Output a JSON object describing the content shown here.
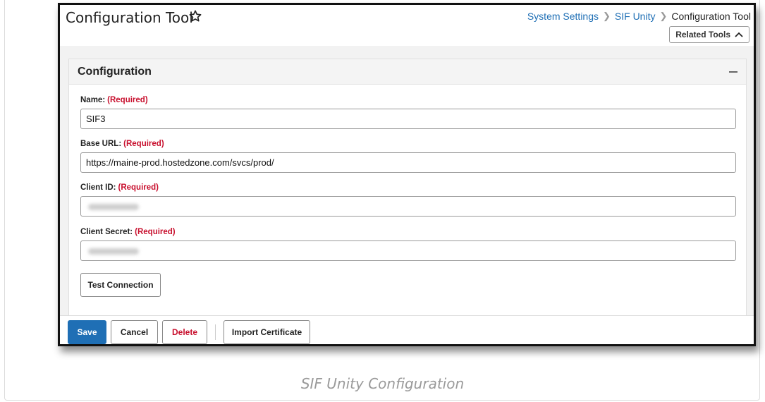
{
  "header": {
    "title": "Configuration Tool",
    "breadcrumb": [
      "System Settings",
      "SIF Unity",
      "Configuration Tool"
    ],
    "related_tools_label": "Related Tools"
  },
  "panel": {
    "title": "Configuration",
    "required_label": "(Required)",
    "fields": [
      {
        "label": "Name:",
        "value": "SIF3"
      },
      {
        "label": "Base URL:",
        "value": "https://maine-prod.hostedzone.com/svcs/prod/"
      },
      {
        "label": "Client ID:",
        "value": ""
      },
      {
        "label": "Client Secret:",
        "value": ""
      }
    ],
    "test_connection_label": "Test Connection"
  },
  "footer": {
    "save_label": "Save",
    "cancel_label": "Cancel",
    "delete_label": "Delete",
    "import_label": "Import Certificate"
  },
  "caption": "SIF Unity Configuration",
  "colors": {
    "link": "#1f6fb5",
    "primary_button": "#1f6fb5",
    "required": "#c8102e",
    "delete_text": "#c8102e"
  },
  "icons": [
    "star-outline-icon",
    "chevron-right-icon",
    "chevron-up-icon",
    "collapse-minus-icon"
  ]
}
